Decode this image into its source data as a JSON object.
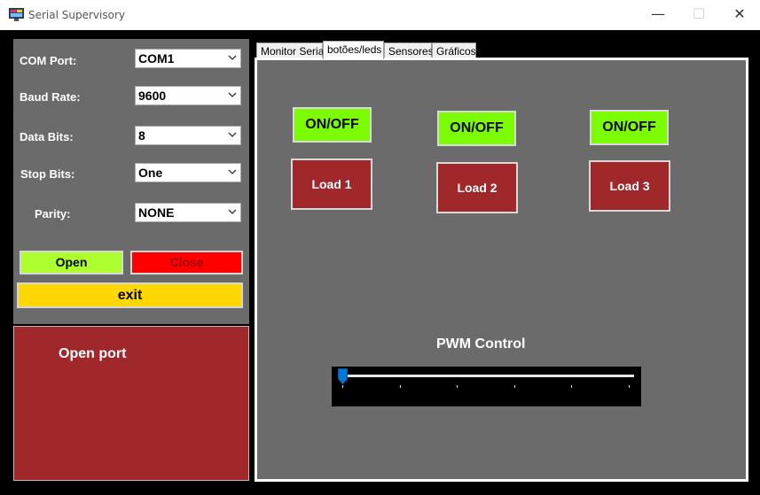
{
  "window": {
    "title": "Serial Supervisory",
    "controls": {
      "minimize": "—",
      "maximize": "☐",
      "close": "✕"
    }
  },
  "settings": {
    "com_port": {
      "label": "COM Port:",
      "value": "COM1"
    },
    "baud_rate": {
      "label": "Baud Rate:",
      "value": "9600"
    },
    "data_bits": {
      "label": "Data Bits:",
      "value": "8"
    },
    "stop_bits": {
      "label": "Stop Bits:",
      "value": "One"
    },
    "parity": {
      "label": "Parity:",
      "value": "NONE"
    }
  },
  "buttons": {
    "open": "Open",
    "close": "Close",
    "exit": "exit"
  },
  "status": {
    "text": "Open port"
  },
  "tabs": [
    {
      "label": "Monitor Serial",
      "active": false
    },
    {
      "label": "botões/leds",
      "active": true
    },
    {
      "label": "Sensores",
      "active": false
    },
    {
      "label": "Gráficos",
      "active": false
    }
  ],
  "loads": [
    {
      "toggle_label": "ON/OFF",
      "load_label": "Load 1"
    },
    {
      "toggle_label": "ON/OFF",
      "load_label": "Load 2"
    },
    {
      "toggle_label": "ON/OFF",
      "load_label": "Load 3"
    }
  ],
  "pwm": {
    "label": "PWM Control",
    "value_fraction": 0.0,
    "tick_count": 6
  },
  "colors": {
    "panel_gray": "#6b6b6b",
    "open_green": "#adff2f",
    "close_red": "#ff0000",
    "exit_yellow": "#ffd700",
    "status_red": "#a0282a",
    "toggle_green": "#7cfc00",
    "load_red": "#a0282a",
    "slider_thumb": "#0078d7"
  }
}
